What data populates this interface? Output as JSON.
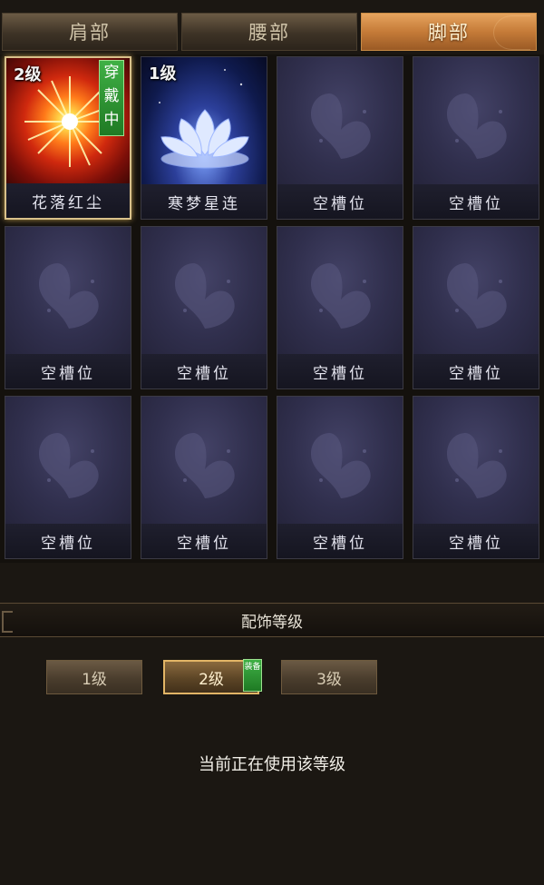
{
  "tabs": [
    "肩部",
    "腰部",
    "脚部"
  ],
  "active_tab": 2,
  "slots": [
    {
      "name": "花落红尘",
      "level": "2级",
      "badge": "穿戴中",
      "type": "fire"
    },
    {
      "name": "寒梦星连",
      "level": "1级",
      "badge": "",
      "type": "lotus"
    },
    {
      "name": "空槽位"
    },
    {
      "name": "空槽位"
    },
    {
      "name": "空槽位"
    },
    {
      "name": "空槽位"
    },
    {
      "name": "空槽位"
    },
    {
      "name": "空槽位"
    },
    {
      "name": "空槽位"
    },
    {
      "name": "空槽位"
    },
    {
      "name": "空槽位"
    },
    {
      "name": "空槽位"
    }
  ],
  "level_section": {
    "title": "配饰等级",
    "buttons": [
      "1级",
      "2级",
      "3级"
    ],
    "active": 1,
    "equipped_tag": "装备",
    "status": "当前正在使用该等级"
  },
  "colors": {
    "accent_orange": "#c57b38",
    "equipped_green": "#2f9a35",
    "empty_slot_bg": "#302f4d"
  },
  "icons": [
    "butterfly-icon",
    "fire-icon",
    "lotus-icon"
  ]
}
